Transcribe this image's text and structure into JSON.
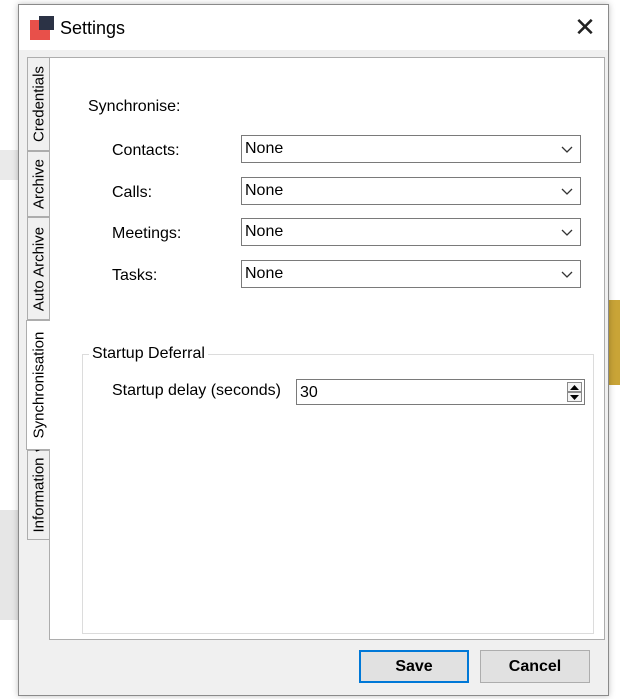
{
  "window": {
    "title": "Settings",
    "close_glyph": "✕"
  },
  "tabs": [
    {
      "label": "Credentials",
      "active": false
    },
    {
      "label": "Archive",
      "active": false
    },
    {
      "label": "Auto Archive",
      "active": false
    },
    {
      "label": "Synchronisation",
      "active": true
    },
    {
      "label": "Information",
      "active": false
    }
  ],
  "sync": {
    "heading": "Synchronise:",
    "rows": [
      {
        "label": "Contacts:",
        "value": "None"
      },
      {
        "label": "Calls:",
        "value": "None"
      },
      {
        "label": "Meetings:",
        "value": "None"
      },
      {
        "label": "Tasks:",
        "value": "None"
      }
    ]
  },
  "startup": {
    "group_title": "Startup Deferral",
    "delay_label": "Startup delay (seconds)",
    "delay_value": "30"
  },
  "buttons": {
    "save": "Save",
    "cancel": "Cancel"
  },
  "colors": {
    "accent": "#0078d7",
    "app_icon_red": "#e8504a",
    "app_icon_dark": "#2b3245"
  }
}
